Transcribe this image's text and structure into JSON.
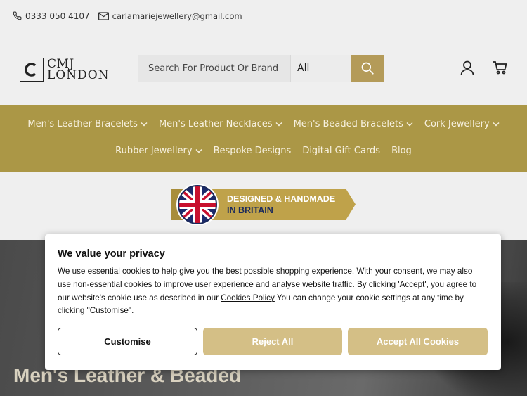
{
  "topbar": {
    "phone": "0333 050 4107",
    "email": "carlamariejewellery@gmail.com"
  },
  "logo": {
    "line1": "CMJ",
    "line2": "LONDON"
  },
  "search": {
    "placeholder": "Search For Product Or Brand",
    "category": "All"
  },
  "nav": {
    "row1": [
      {
        "label": "Men's Leather Bracelets",
        "dropdown": true
      },
      {
        "label": "Men's Leather Necklaces",
        "dropdown": true
      },
      {
        "label": "Men's Beaded Bracelets",
        "dropdown": true
      },
      {
        "label": "Cork Jewellery",
        "dropdown": true
      }
    ],
    "row2": [
      {
        "label": "Rubber Jewellery",
        "dropdown": true
      },
      {
        "label": "Bespoke Designs",
        "dropdown": false
      },
      {
        "label": "Digital Gift Cards",
        "dropdown": false
      },
      {
        "label": "Blog",
        "dropdown": false
      }
    ]
  },
  "badge": {
    "line1": "DESIGNED & HANDMADE",
    "line2": "IN BRITAIN"
  },
  "hero": {
    "title": "Men's Leather & Beaded"
  },
  "cookie": {
    "title": "We value your privacy",
    "body_part1": "We use essential cookies to help give you the best possible shopping experience. With your consent, we may also use non-essential cookies to improve user experience and analyse website traffic. By clicking 'Accept', you agree to our website's cookie use as described in our ",
    "link": "Cookies Policy",
    "body_part2": " You can change your cookie settings at any time by clicking \"Customise\".",
    "customise": "Customise",
    "reject": "Reject All",
    "accept": "Accept All Cookies"
  },
  "colors": {
    "gold": "#ab9746",
    "button_gold": "#d4bf86",
    "search_gold": "#b49b59"
  }
}
